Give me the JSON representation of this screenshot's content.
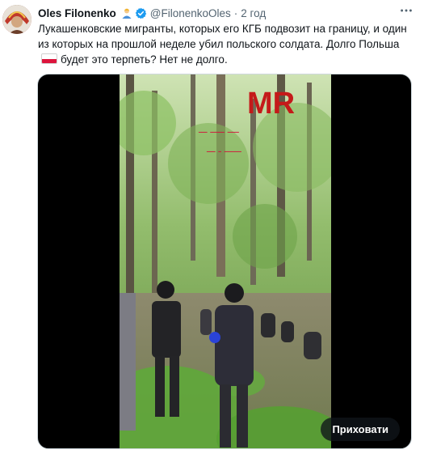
{
  "tweet": {
    "author_name": "Oles Filonenko",
    "handle": "@FilonenkoOles",
    "separator": "·",
    "time": "2 год",
    "more_icon": "more-horizontal-icon",
    "text_part1": "Лукашенковские мигранты, которых его КГБ подвозит на границу, и один из которых на прошлой неделе убил польского солдата. Долго Польша",
    "text_part2": "будет это терпеть? Нет не долго.",
    "flag_icon": "poland-flag-icon",
    "verified_color": "#1d9bf0"
  },
  "media": {
    "watermark": "MR",
    "hide_label": "Приховати"
  }
}
